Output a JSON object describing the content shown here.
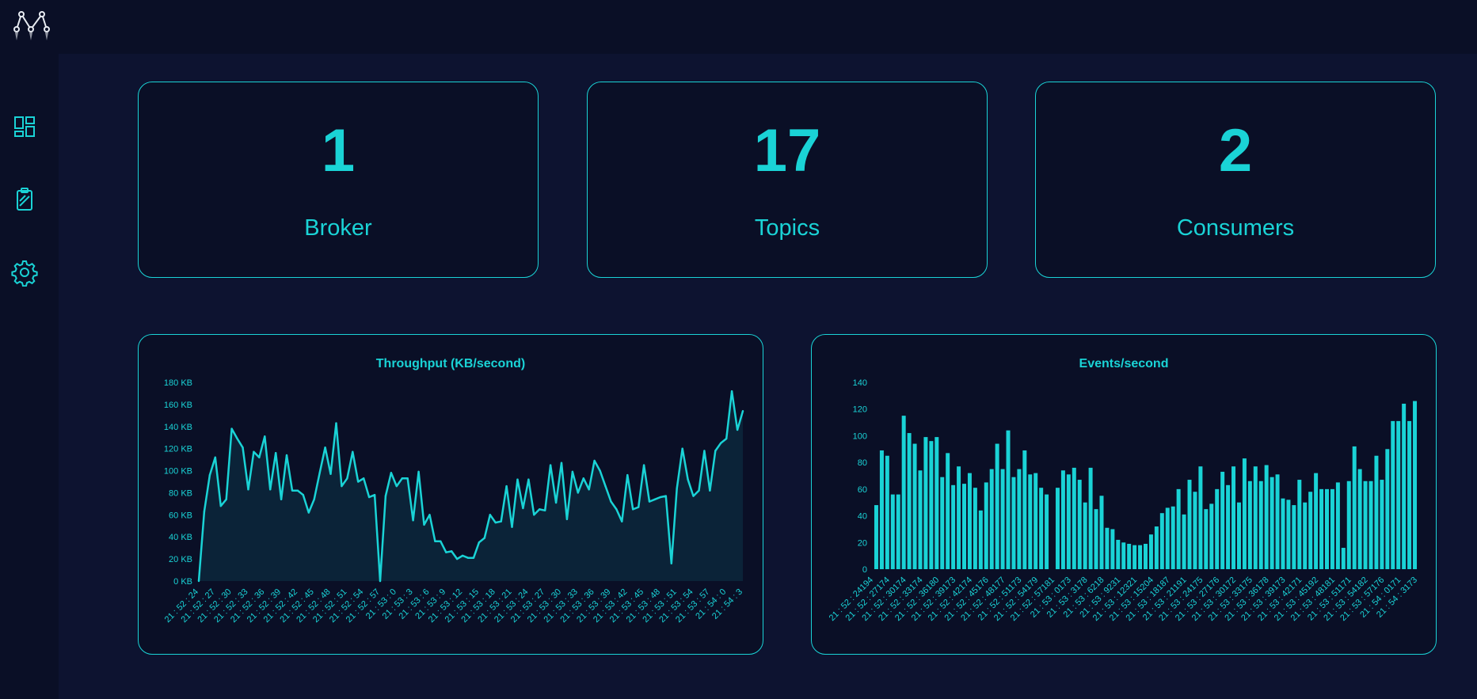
{
  "nav": {
    "items": [
      {
        "label": "Dashboard",
        "icon": "dashboard-icon"
      },
      {
        "label": "Topics",
        "icon": "clipboard-icon"
      },
      {
        "label": "Settings",
        "icon": "gear-icon"
      }
    ]
  },
  "stats": {
    "broker": {
      "value": "1",
      "label": "Broker"
    },
    "topics": {
      "value": "17",
      "label": "Topics"
    },
    "consumers": {
      "value": "2",
      "label": "Consumers"
    }
  },
  "colors": {
    "accent": "#1ad3d6",
    "background": "#0d1330",
    "panel": "#0a0f26"
  },
  "chart_data": [
    {
      "type": "area",
      "title": "Throughput (KB/second)",
      "xlabel": "",
      "ylabel": "",
      "ylim": [
        0,
        180
      ],
      "y_ticks": [
        "0 KB",
        "20 KB",
        "40 KB",
        "60 KB",
        "80 KB",
        "100 KB",
        "120 KB",
        "140 KB",
        "160 KB",
        "180 KB"
      ],
      "grid": false,
      "x_tick_labels": [
        "21 : 52 : 24",
        "21 : 52 : 27",
        "21 : 52 : 30",
        "21 : 52 : 33",
        "21 : 52 : 36",
        "21 : 52 : 39",
        "21 : 52 : 42",
        "21 : 52 : 45",
        "21 : 52 : 48",
        "21 : 52 : 51",
        "21 : 52 : 54",
        "21 : 52 : 57",
        "21 : 53 : 0",
        "21 : 53 : 3",
        "21 : 53 : 6",
        "21 : 53 : 9",
        "21 : 53 : 12",
        "21 : 53 : 15",
        "21 : 53 : 18",
        "21 : 53 : 21",
        "21 : 53 : 24",
        "21 : 53 : 27",
        "21 : 53 : 30",
        "21 : 53 : 33",
        "21 : 53 : 36",
        "21 : 53 : 39",
        "21 : 53 : 42",
        "21 : 53 : 45",
        "21 : 53 : 48",
        "21 : 53 : 51",
        "21 : 53 : 54",
        "21 : 53 : 57",
        "21 : 54 : 0",
        "21 : 54 : 3"
      ],
      "series": [
        {
          "values": [
            0,
            63,
            96,
            112,
            68,
            74,
            138,
            129,
            121,
            83,
            117,
            112,
            131,
            83,
            116,
            74,
            114,
            82,
            82,
            78,
            62,
            74,
            98,
            121,
            97,
            143,
            86,
            93,
            117,
            90,
            93,
            76,
            78,
            0,
            77,
            98,
            86,
            93,
            93,
            55,
            99,
            51,
            60,
            36,
            36,
            26,
            27,
            20,
            23,
            21,
            21,
            35,
            39,
            60,
            53,
            54,
            86,
            49,
            92,
            66,
            92,
            60,
            65,
            64,
            105,
            71,
            107,
            56,
            99,
            80,
            93,
            83,
            109,
            100,
            86,
            72,
            65,
            54,
            96,
            65,
            67,
            105,
            72,
            74,
            76,
            77,
            16,
            84,
            120,
            92,
            77,
            82,
            118,
            82,
            118,
            125,
            129,
            172,
            137,
            154
          ]
        }
      ]
    },
    {
      "type": "bar",
      "title": "Events/second",
      "xlabel": "",
      "ylabel": "",
      "ylim": [
        0,
        140
      ],
      "y_ticks": [
        "0",
        "20",
        "40",
        "60",
        "80",
        "100",
        "120",
        "140"
      ],
      "grid": false,
      "x_tick_labels": [
        "21 : 52 : 24194",
        "21 : 52 : 27174",
        "21 : 52 : 30174",
        "21 : 52 : 33174",
        "21 : 52 : 36180",
        "21 : 52 : 39173",
        "21 : 52 : 42174",
        "21 : 52 : 45176",
        "21 : 52 : 48177",
        "21 : 52 : 51173",
        "21 : 52 : 54179",
        "21 : 52 : 57181",
        "21 : 53 : 0173",
        "21 : 53 : 3178",
        "21 : 53 : 6218",
        "21 : 53 : 9231",
        "21 : 53 : 12321",
        "21 : 53 : 15204",
        "21 : 53 : 18187",
        "21 : 53 : 21191",
        "21 : 53 : 24175",
        "21 : 53 : 27176",
        "21 : 53 : 30172",
        "21 : 53 : 33175",
        "21 : 53 : 36178",
        "21 : 53 : 39173",
        "21 : 53 : 42171",
        "21 : 53 : 45192",
        "21 : 53 : 48181",
        "21 : 53 : 51171",
        "21 : 53 : 54182",
        "21 : 53 : 57176",
        "21 : 54 : 0171",
        "21 : 54 : 3173"
      ],
      "series": [
        {
          "values": [
            48,
            89,
            85,
            56,
            56,
            115,
            102,
            94,
            74,
            99,
            96,
            99,
            69,
            87,
            63,
            77,
            64,
            72,
            61,
            44,
            65,
            75,
            94,
            75,
            104,
            69,
            75,
            89,
            71,
            72,
            61,
            56,
            0,
            61,
            74,
            71,
            76,
            67,
            50,
            76,
            45,
            55,
            31,
            30,
            22,
            20,
            19,
            18,
            18,
            19,
            26,
            32,
            42,
            46,
            47,
            60,
            41,
            67,
            58,
            77,
            45,
            49,
            60,
            73,
            63,
            77,
            50,
            83,
            66,
            77,
            66,
            78,
            69,
            71,
            53,
            52,
            48,
            67,
            50,
            58,
            72,
            60,
            60,
            60,
            65,
            16,
            66,
            92,
            75,
            66,
            66,
            85,
            67,
            90,
            111,
            111,
            124,
            111,
            126
          ]
        }
      ]
    }
  ]
}
